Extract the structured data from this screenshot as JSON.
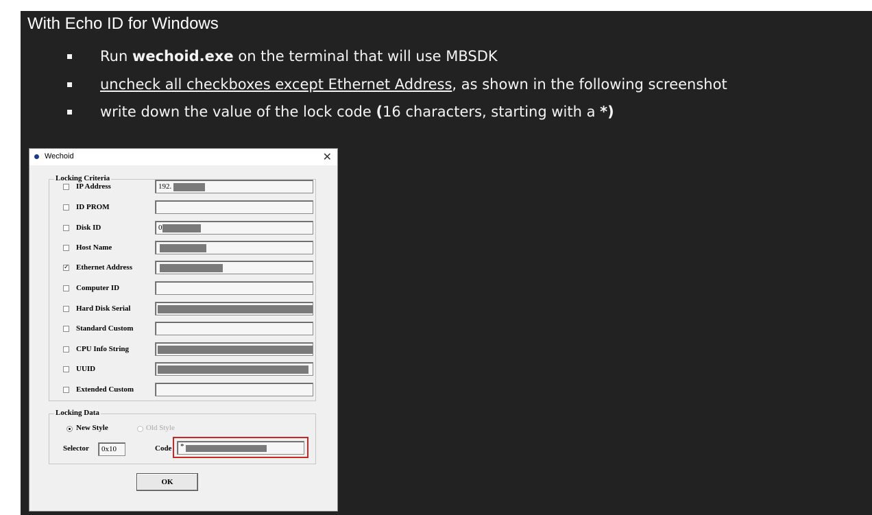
{
  "slide": {
    "title": "With Echo ID for Windows",
    "bullets": [
      {
        "pre": "Run ",
        "bold": "wechoid.exe",
        "post": " on the terminal  that will use MBSDK"
      },
      {
        "underlined": "uncheck all checkboxes except Ethernet  Address",
        "post": ", as shown in the following screenshot"
      },
      {
        "pre": "write down the value of the lock code ",
        "bold": "(",
        "mid": "16 characters, starting with a ",
        "bold2": "*)"
      }
    ]
  },
  "dialog": {
    "title": "Wechoid",
    "close_glyph": "✕",
    "locking_criteria_label": "Locking Criteria",
    "criteria": [
      {
        "label": "IP Address",
        "checked": false,
        "value": "192."
      },
      {
        "label": "ID PROM",
        "checked": false,
        "value": ""
      },
      {
        "label": "Disk ID",
        "checked": false,
        "value": "0x"
      },
      {
        "label": "Host Name",
        "checked": false,
        "value": ""
      },
      {
        "label": "Ethernet Address",
        "checked": true,
        "value": ""
      },
      {
        "label": "Computer ID",
        "checked": false,
        "value": ""
      },
      {
        "label": "Hard Disk Serial",
        "checked": false,
        "value": ""
      },
      {
        "label": "Standard Custom",
        "checked": false,
        "value": ""
      },
      {
        "label": "CPU Info String",
        "checked": false,
        "value": ""
      },
      {
        "label": "UUID",
        "checked": false,
        "value": ""
      },
      {
        "label": "Extended Custom",
        "checked": false,
        "value": ""
      }
    ],
    "locking_data_label": "Locking Data",
    "new_style_label": "New Style",
    "old_style_label": "Old Style",
    "selector_label": "Selector",
    "selector_value": "0x10",
    "code_label": "Code",
    "code_value": "*",
    "ok_label": "OK",
    "highlight_color": "#c62828"
  }
}
